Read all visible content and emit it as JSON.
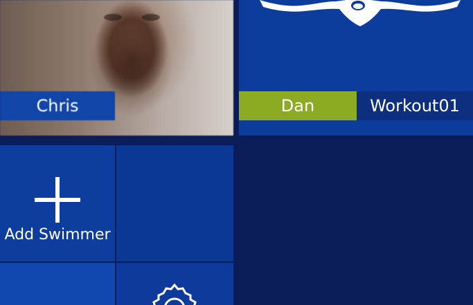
{
  "tiles": {
    "chris": {
      "name": "Chris"
    },
    "dan": {
      "name": "Dan",
      "workout": "Workout01"
    },
    "add_swimmer": {
      "label": "Add Swimmer"
    }
  },
  "icons": {
    "add": "plus-icon",
    "settings": "gear-icon",
    "swimmer": "swimmer-icon"
  },
  "colors": {
    "background": "#0b1d58",
    "tile_blue": "#0e3da0",
    "name_bar_blue": "#1145a8",
    "name_bar_green": "#8cab23",
    "text": "#ffffff"
  }
}
